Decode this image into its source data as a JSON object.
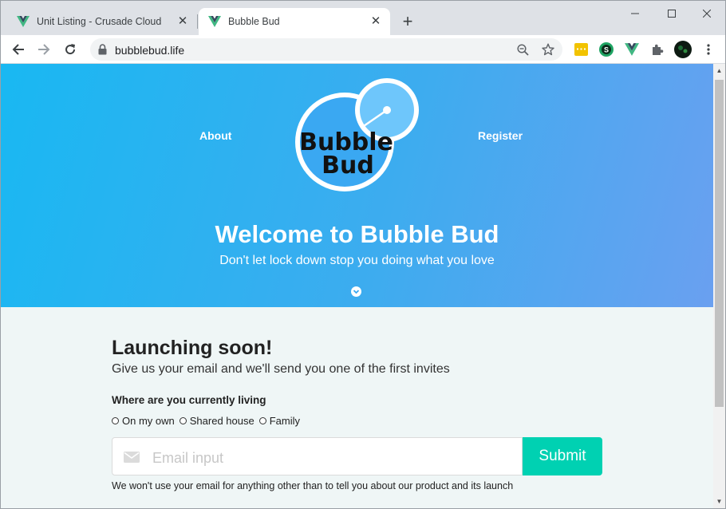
{
  "browser": {
    "tabs": [
      {
        "title": "Unit Listing - Crusade Cloud",
        "active": false,
        "favicon": "vue-logo-icon"
      },
      {
        "title": "Bubble Bud",
        "active": true,
        "favicon": "vue-logo-icon"
      }
    ],
    "url": "bubblebud.life",
    "extension_icons": [
      "zoom-out-icon",
      "bookmark-star-icon",
      "yellow-extension-icon",
      "green-s-extension-icon",
      "vue-devtools-icon",
      "puzzle-extensions-icon",
      "profile-avatar-icon",
      "more-menu-icon"
    ]
  },
  "hero": {
    "nav_left": "About",
    "nav_right": "Register",
    "logo_text_line1": "Bubble",
    "logo_text_line2": "Bud",
    "heading": "Welcome to Bubble Bud",
    "tagline": "Don't let lock down stop you doing what you love"
  },
  "signup": {
    "heading": "Launching soon!",
    "subheading": "Give us your email and we'll send you one of the first invites",
    "question": "Where are you currently living",
    "options": [
      "On my own",
      "Shared house",
      "Family"
    ],
    "email_placeholder": "Email input",
    "submit_label": "Submit",
    "note": "We won't use your email for anything other than to tell you about our product and its launch"
  },
  "colors": {
    "hero_gradient_start": "#19b8f2",
    "hero_gradient_end": "#6aa0f0",
    "submit": "#00d1b2",
    "page_bg": "#eff6f6"
  }
}
